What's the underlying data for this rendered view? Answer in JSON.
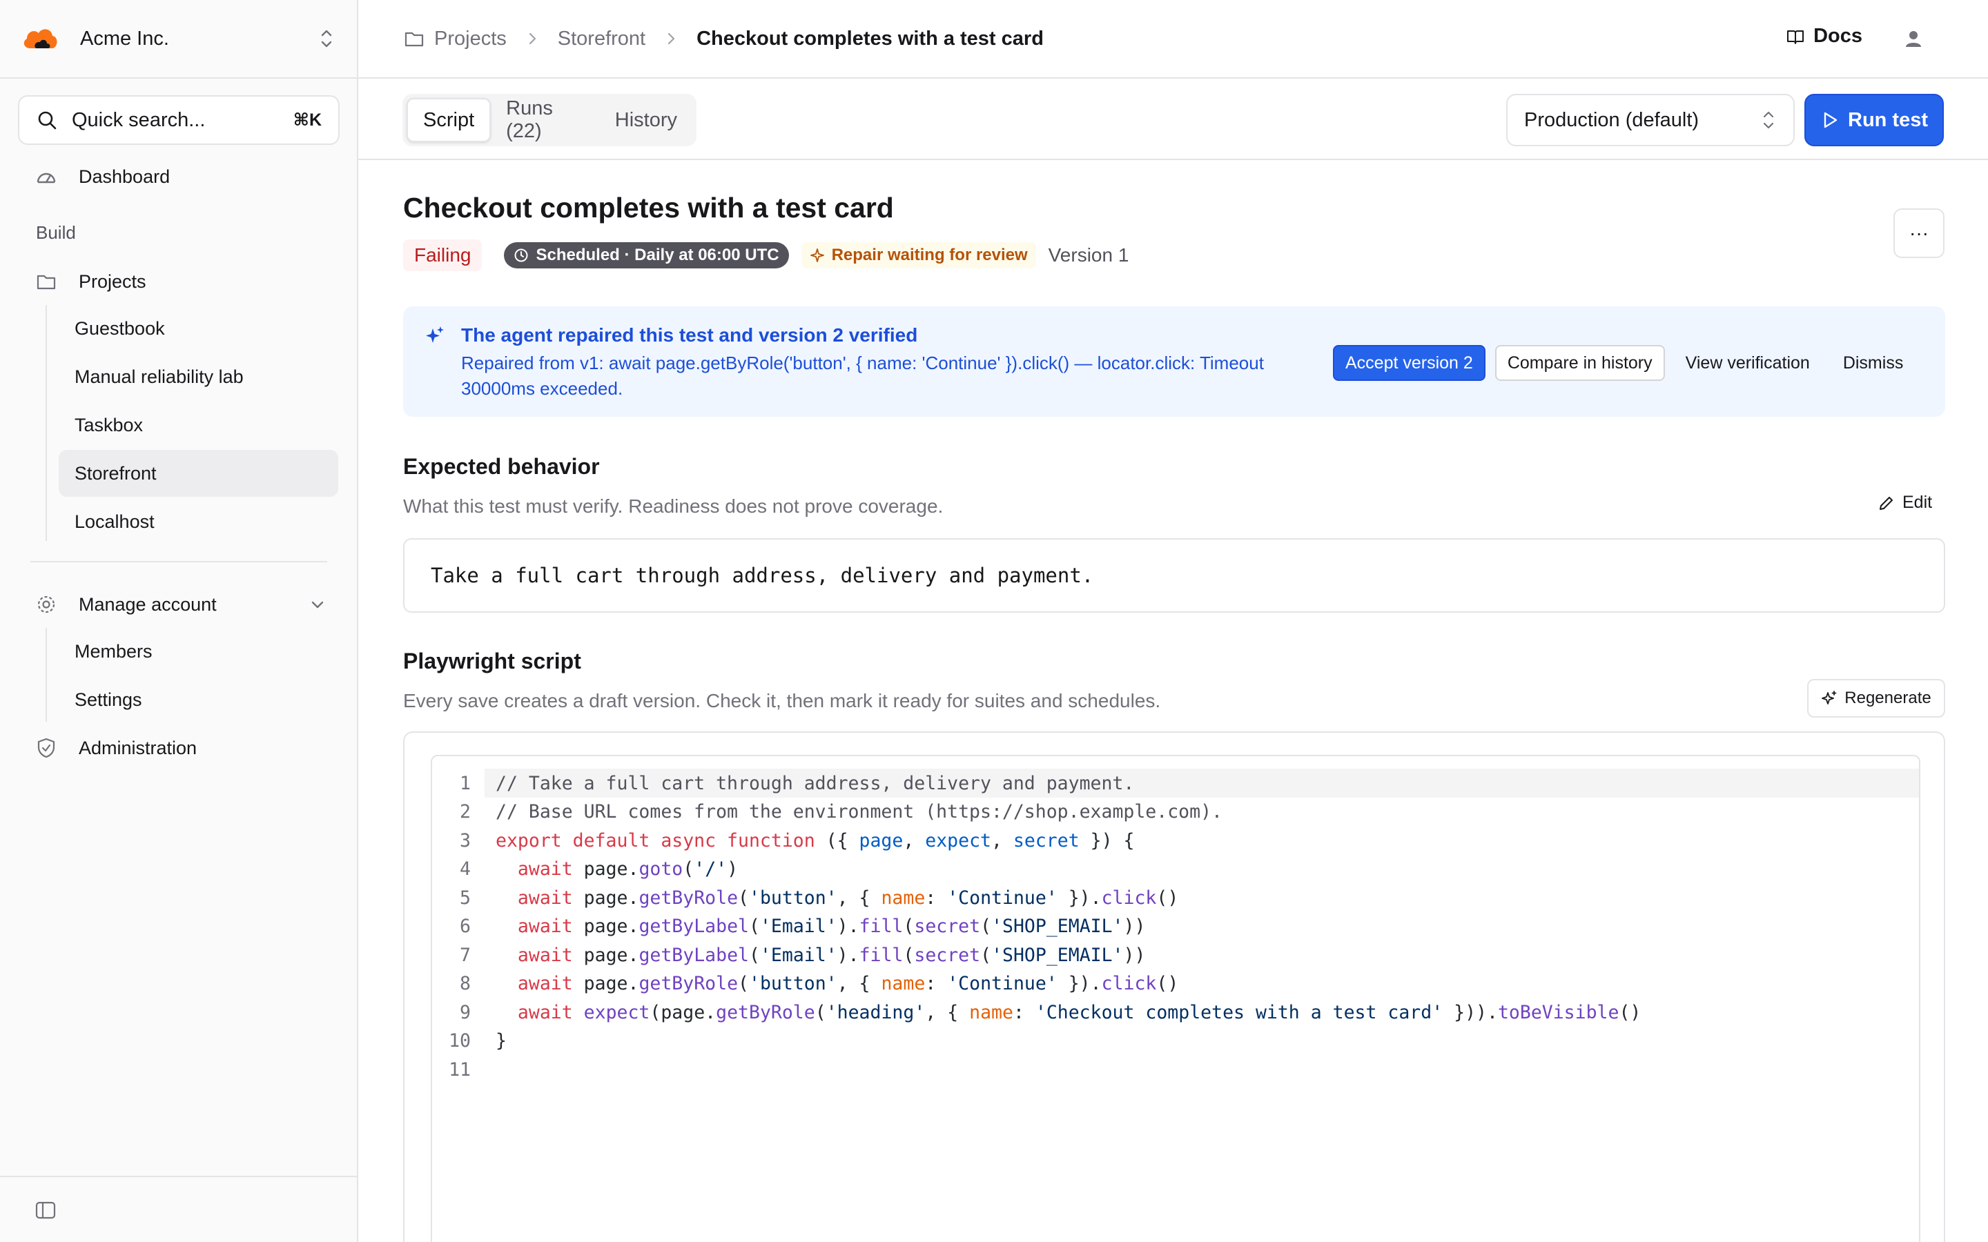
{
  "sidebar": {
    "org_name": "Acme Inc.",
    "search_placeholder": "Quick search...",
    "search_shortcut": "⌘K",
    "dashboard": "Dashboard",
    "section_build": "Build",
    "projects": "Projects",
    "project_items": [
      "Guestbook",
      "Manual reliability lab",
      "Taskbox",
      "Storefront",
      "Localhost"
    ],
    "manage_account": "Manage account",
    "account_items": [
      "Members",
      "Settings"
    ],
    "administration": "Administration"
  },
  "breadcrumb": [
    "Projects",
    "Storefront",
    "Checkout completes with a test card"
  ],
  "header": {
    "docs": "Docs"
  },
  "toolbar": {
    "tabs": [
      "Script",
      "Runs (22)",
      "History"
    ],
    "active_tab": "Script",
    "environment": "Production (default)",
    "run_label": "Run test"
  },
  "test": {
    "title": "Checkout completes with a test card",
    "status": "Failing",
    "schedule": "Scheduled · Daily at 06:00 UTC",
    "repair": "Repair waiting for review",
    "version": "Version 1",
    "more": "···"
  },
  "alert": {
    "title": "The agent repaired this test and version 2 verified",
    "body": "Repaired from v1: await page.getByRole('button', { name: 'Continue' }).click() — locator.click: Timeout 30000ms exceeded.",
    "accept": "Accept version 2",
    "compare": "Compare in history",
    "verify": "View verification",
    "dismiss": "Dismiss"
  },
  "expected": {
    "title": "Expected behavior",
    "description": "What this test must verify. Readiness does not prove coverage.",
    "edit": "Edit",
    "text": "Take a full cart through address, delivery and payment."
  },
  "script": {
    "title": "Playwright script",
    "description": "Every save creates a draft version. Check it, then mark it ready for suites and schedules.",
    "regenerate": "Regenerate",
    "line_numbers": [
      "1",
      "2",
      "3",
      "4",
      "5",
      "6",
      "7",
      "8",
      "9",
      "10",
      "11"
    ],
    "lines": [
      [
        [
          "c",
          "// Take a full cart through address, delivery and payment."
        ]
      ],
      [
        [
          "c",
          "// Base URL comes from the environment (https://shop.example.com)."
        ]
      ],
      [
        [
          "k",
          "export default async function "
        ],
        [
          "t",
          "({ "
        ],
        [
          "p",
          "page"
        ],
        [
          "t",
          ", "
        ],
        [
          "p",
          "expect"
        ],
        [
          "t",
          ", "
        ],
        [
          "p",
          "secret"
        ],
        [
          "t",
          " }) {"
        ]
      ],
      [
        [
          "t",
          "  "
        ],
        [
          "k",
          "await "
        ],
        [
          "t",
          "page."
        ],
        [
          "f",
          "goto"
        ],
        [
          "t",
          "("
        ],
        [
          "s",
          "'/'"
        ],
        [
          "t",
          ")"
        ]
      ],
      [
        [
          "t",
          "  "
        ],
        [
          "k",
          "await "
        ],
        [
          "t",
          "page."
        ],
        [
          "f",
          "getByRole"
        ],
        [
          "t",
          "("
        ],
        [
          "s",
          "'button'"
        ],
        [
          "t",
          ", { "
        ],
        [
          "o",
          "name"
        ],
        [
          "t",
          ": "
        ],
        [
          "s",
          "'Continue'"
        ],
        [
          "t",
          " })."
        ],
        [
          "f",
          "click"
        ],
        [
          "t",
          "()"
        ]
      ],
      [
        [
          "t",
          "  "
        ],
        [
          "k",
          "await "
        ],
        [
          "t",
          "page."
        ],
        [
          "f",
          "getByLabel"
        ],
        [
          "t",
          "("
        ],
        [
          "s",
          "'Email'"
        ],
        [
          "t",
          ")."
        ],
        [
          "f",
          "fill"
        ],
        [
          "t",
          "("
        ],
        [
          "f",
          "secret"
        ],
        [
          "t",
          "("
        ],
        [
          "s",
          "'SHOP_EMAIL'"
        ],
        [
          "t",
          "))"
        ]
      ],
      [
        [
          "t",
          "  "
        ],
        [
          "k",
          "await "
        ],
        [
          "t",
          "page."
        ],
        [
          "f",
          "getByLabel"
        ],
        [
          "t",
          "("
        ],
        [
          "s",
          "'Email'"
        ],
        [
          "t",
          ")."
        ],
        [
          "f",
          "fill"
        ],
        [
          "t",
          "("
        ],
        [
          "f",
          "secret"
        ],
        [
          "t",
          "("
        ],
        [
          "s",
          "'SHOP_EMAIL'"
        ],
        [
          "t",
          "))"
        ]
      ],
      [
        [
          "t",
          "  "
        ],
        [
          "k",
          "await "
        ],
        [
          "t",
          "page."
        ],
        [
          "f",
          "getByRole"
        ],
        [
          "t",
          "("
        ],
        [
          "s",
          "'button'"
        ],
        [
          "t",
          ", { "
        ],
        [
          "o",
          "name"
        ],
        [
          "t",
          ": "
        ],
        [
          "s",
          "'Continue'"
        ],
        [
          "t",
          " })."
        ],
        [
          "f",
          "click"
        ],
        [
          "t",
          "()"
        ]
      ],
      [
        [
          "t",
          "  "
        ],
        [
          "k",
          "await "
        ],
        [
          "f",
          "expect"
        ],
        [
          "t",
          "(page."
        ],
        [
          "f",
          "getByRole"
        ],
        [
          "t",
          "("
        ],
        [
          "s",
          "'heading'"
        ],
        [
          "t",
          ", { "
        ],
        [
          "o",
          "name"
        ],
        [
          "t",
          ": "
        ],
        [
          "s",
          "'Checkout completes with a test card'"
        ],
        [
          "t",
          " }))."
        ],
        [
          "f",
          "toBeVisible"
        ],
        [
          "t",
          "()"
        ]
      ],
      [
        [
          "t",
          "}"
        ]
      ],
      [
        [
          "t",
          ""
        ]
      ]
    ]
  }
}
